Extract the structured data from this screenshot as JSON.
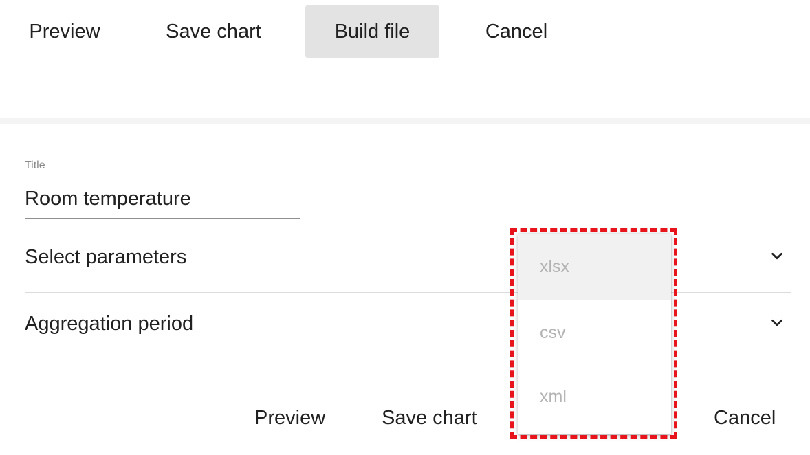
{
  "top_toolbar": {
    "preview_label": "Preview",
    "save_chart_label": "Save chart",
    "build_file_label": "Build file",
    "cancel_label": "Cancel"
  },
  "form": {
    "title_label": "Title",
    "title_value": "Room temperature",
    "select_parameters_label": "Select parameters",
    "aggregation_period_label": "Aggregation period"
  },
  "bottom_actions": {
    "preview_label": "Preview",
    "save_chart_label": "Save chart",
    "cancel_label": "Cancel"
  },
  "file_format_dropdown": {
    "options": [
      "xlsx",
      "csv",
      "xml"
    ],
    "hovered_option": "xlsx"
  },
  "icons": {
    "select_parameters_chevron": "chevron-down-icon",
    "aggregation_period_chevron": "chevron-down-icon"
  },
  "colors": {
    "highlight": "#e8141b",
    "active_button_bg": "#e3e3e3",
    "option_text": "#b3b3b3"
  }
}
